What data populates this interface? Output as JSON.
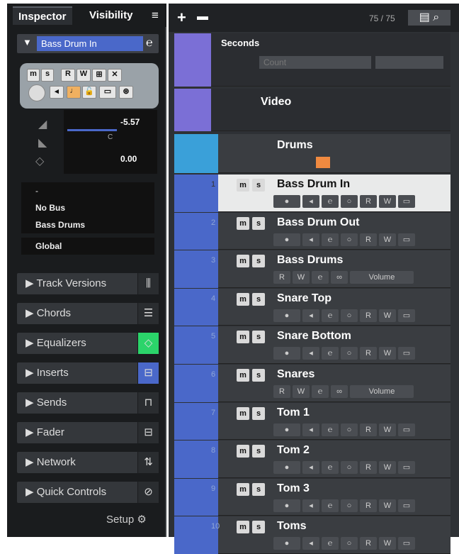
{
  "inspector": {
    "tab_inspector": "Inspector",
    "tab_visibility": "Visibility",
    "track_name": "Bass Drum In",
    "fader_volume": "-5.57",
    "fader_pan": "C",
    "fader_delay": "0.00",
    "input_routing": "-",
    "output_bus": "No Bus",
    "group_bus": "Bass Drums",
    "automation": "Global",
    "sections": [
      "Track Versions",
      "Chords",
      "Equalizers",
      "Inserts",
      "Sends",
      "Fader",
      "Network",
      "Quick Controls"
    ],
    "setup": "Setup"
  },
  "project": {
    "counter": "75 / 75",
    "ruler": "Seconds",
    "count_field": "Count",
    "video_label": "Video",
    "folder": "Drums",
    "tracks": [
      {
        "num": "1",
        "name": "Bass Drum In"
      },
      {
        "num": "2",
        "name": "Bass Drum Out"
      },
      {
        "num": "3",
        "name": "Bass Drums",
        "volume": "Volume"
      },
      {
        "num": "4",
        "name": "Snare Top"
      },
      {
        "num": "5",
        "name": "Snare Bottom"
      },
      {
        "num": "6",
        "name": "Snares",
        "volume": "Volume"
      },
      {
        "num": "7",
        "name": "Tom 1"
      },
      {
        "num": "8",
        "name": "Tom 2"
      },
      {
        "num": "9",
        "name": "Tom 3"
      },
      {
        "num": "10",
        "name": "Toms"
      }
    ]
  },
  "colors": {
    "track_blue": "#4a68c9",
    "folder_blue": "#3aa0d9",
    "video_purple": "#7b6fd6",
    "group_green": "#2bd46a",
    "selected_bg": "#e9eaea"
  }
}
